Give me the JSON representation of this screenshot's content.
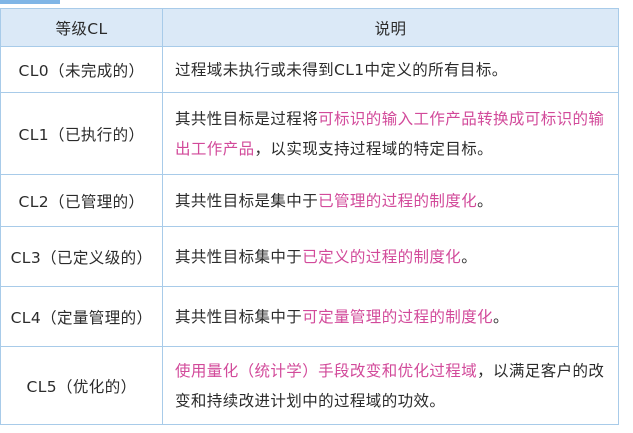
{
  "table": {
    "headers": [
      "等级CL",
      "说明"
    ],
    "rows": [
      {
        "level": "CL0（未完成的）",
        "desc": [
          {
            "t": "过程域未执行或未得到CL1中定义的所有目标。",
            "hl": false
          }
        ]
      },
      {
        "level": "CL1（已执行的）",
        "desc": [
          {
            "t": "其共性目标是过程将",
            "hl": false
          },
          {
            "t": "可标识的输入工作产品转换成可标识的输出工作产品",
            "hl": true
          },
          {
            "t": "，以实现支持过程域的特定目标。",
            "hl": false
          }
        ]
      },
      {
        "level": "CL2（已管理的）",
        "desc": [
          {
            "t": "其共性目标是集中于",
            "hl": false
          },
          {
            "t": "已管理的过程的制度化",
            "hl": true
          },
          {
            "t": "。",
            "hl": false
          }
        ]
      },
      {
        "level": "CL3（已定义级的）",
        "desc": [
          {
            "t": "其共性目标集中于",
            "hl": false
          },
          {
            "t": "已定义的过程的制度化",
            "hl": true
          },
          {
            "t": "。",
            "hl": false
          }
        ]
      },
      {
        "level": "CL4（定量管理的）",
        "desc": [
          {
            "t": "其共性目标集中于",
            "hl": false
          },
          {
            "t": "可定量管理的过程的制度化",
            "hl": true
          },
          {
            "t": "。",
            "hl": false
          }
        ]
      },
      {
        "level": "CL5（优化的）",
        "desc": [
          {
            "t": "使用量化（统计学）手段改变和优化过程域",
            "hl": true
          },
          {
            "t": "，以满足客户的改变和持续改进计划中的过程域的功效。",
            "hl": false
          }
        ]
      }
    ]
  },
  "colors": {
    "border": "#a8cbe9",
    "header_bg": "#dbe9f7",
    "highlight": "#d24a9a",
    "text": "#2b2b2b"
  }
}
